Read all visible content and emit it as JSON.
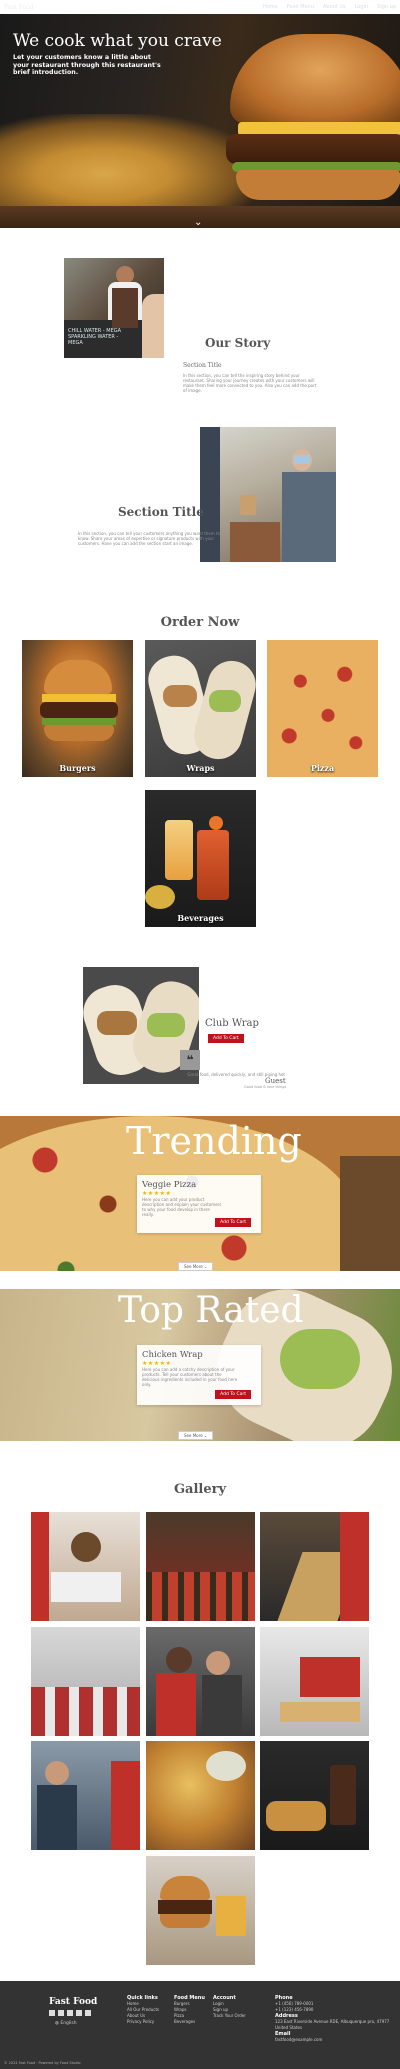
{
  "header": {
    "brand": "Fast Food",
    "nav": [
      "Home",
      "Food Menu",
      "About Us",
      "Login",
      "Sign up"
    ]
  },
  "hero": {
    "title": "We cook what you crave",
    "subtitle": "Let your customers know a little about your restaurant through this restaurant's brief introduction."
  },
  "story": {
    "title": "Our Story",
    "section_title": "Section Title",
    "text": "In this section, you can tell the inspiring story behind your restaurant. Sharing your journey creates with your customers will make them feel more connected to you. Also you can add the port of image."
  },
  "section2": {
    "title": "Section Title",
    "text": "In this section, you can tell your customers anything you want them to know. Share your areas of expertise or signature products with your customers. Have you can add the section start an image."
  },
  "order": {
    "title": "Order Now",
    "items": [
      "Burgers",
      "Wraps",
      "Pizza",
      "Beverages"
    ]
  },
  "featured": {
    "name": "Club Wrap",
    "button": "Add To Cart",
    "quote": "Great food, delivered quickly, and still piping hot",
    "author": "Guest",
    "date": "Good food & love things"
  },
  "trending": {
    "title": "Trending",
    "item": "Veggie Pizza",
    "stars": "★★★★★",
    "text": "Here you can add your product description and explain your customers to why your food develop in there really.",
    "button": "Add To Cart",
    "see_more": "See More"
  },
  "top_rated": {
    "title": "Top Rated",
    "item": "Chicken Wrap",
    "stars": "★★★★★",
    "text": "Here you can add a catchy description of your products. Tell your customers about the delicious ingredients included in your food here only.",
    "button": "Add To Cart",
    "see_more": "See More"
  },
  "gallery": {
    "title": "Gallery"
  },
  "footer": {
    "brand": "Fast Food",
    "lang": "English",
    "quick_links": {
      "title": "Quick links",
      "items": [
        "Home",
        "All Our Products",
        "About Us",
        "Privacy Policy"
      ]
    },
    "food_menu": {
      "title": "Food Menu",
      "items": [
        "Burgers",
        "Wraps",
        "Pizza",
        "Beverages"
      ]
    },
    "account": {
      "title": "Account",
      "items": [
        "Login",
        "Sign up",
        "Track Your Order"
      ]
    },
    "phone": {
      "title": "Phone",
      "items": [
        "+1 (456) 789-0001",
        "+1 (123) 456-7890"
      ]
    },
    "address": {
      "title": "Address",
      "text": "123 East Riverside Avenue RDE, Albuquerque pro, 47977 United States"
    },
    "email": {
      "title": "Email",
      "text": "fastfood@example.com"
    },
    "copyright": "© 2024 Fast Food · Powered by Food Studio"
  },
  "colors": {
    "accent": "#c0121b",
    "footer_bg": "#333333",
    "star": "#f5b301"
  }
}
